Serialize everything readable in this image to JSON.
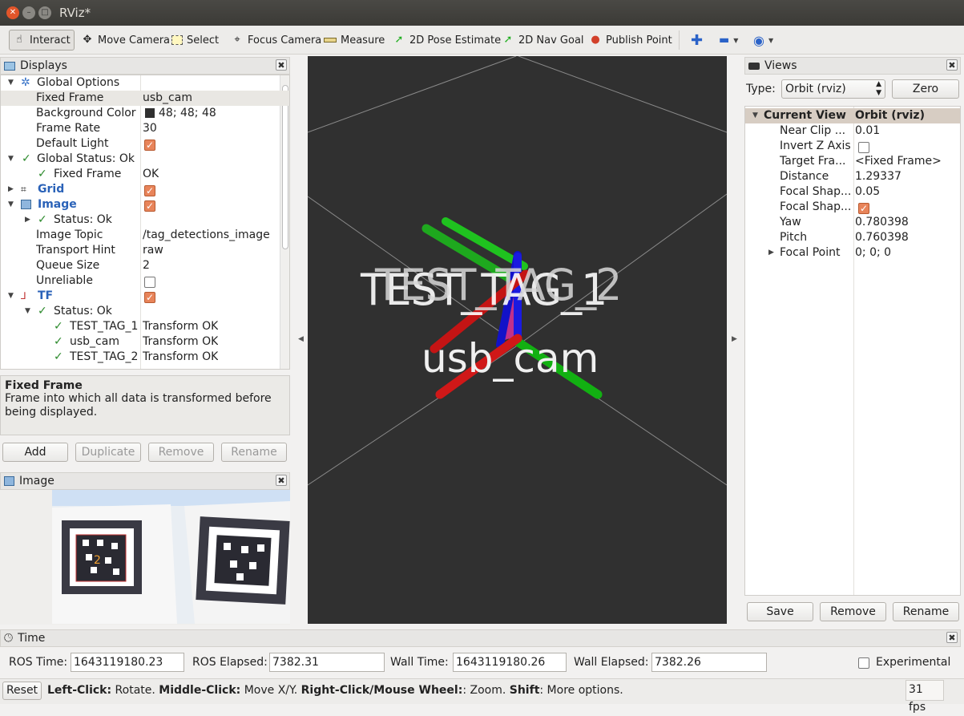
{
  "window": {
    "title": "RViz*"
  },
  "toolbar": {
    "interact": "Interact",
    "move_camera": "Move Camera",
    "select": "Select",
    "focus_camera": "Focus Camera",
    "measure": "Measure",
    "pose_estimate": "2D Pose Estimate",
    "nav_goal": "2D Nav Goal",
    "publish_point": "Publish Point"
  },
  "displays": {
    "title": "Displays",
    "rows": [
      {
        "label": "Global Options",
        "value": ""
      },
      {
        "label": "Fixed Frame",
        "value": "usb_cam"
      },
      {
        "label": "Background Color",
        "value": "48; 48; 48"
      },
      {
        "label": "Frame Rate",
        "value": "30"
      },
      {
        "label": "Default Light",
        "value": ""
      },
      {
        "label": "Global Status: Ok",
        "value": ""
      },
      {
        "label": "Fixed Frame",
        "value": "OK"
      },
      {
        "label": "Grid",
        "value": ""
      },
      {
        "label": "Image",
        "value": ""
      },
      {
        "label": "Status: Ok",
        "value": ""
      },
      {
        "label": "Image Topic",
        "value": "/tag_detections_image"
      },
      {
        "label": "Transport Hint",
        "value": "raw"
      },
      {
        "label": "Queue Size",
        "value": "2"
      },
      {
        "label": "Unreliable",
        "value": ""
      },
      {
        "label": "TF",
        "value": ""
      },
      {
        "label": "Status: Ok",
        "value": ""
      },
      {
        "label": "TEST_TAG_1",
        "value": "Transform OK"
      },
      {
        "label": "usb_cam",
        "value": "Transform OK"
      },
      {
        "label": "TEST_TAG_2",
        "value": "Transform OK"
      }
    ],
    "desc_title": "Fixed Frame",
    "desc_text": "Frame into which all data is transformed before being displayed.",
    "buttons": {
      "add": "Add",
      "duplicate": "Duplicate",
      "remove": "Remove",
      "rename": "Rename"
    }
  },
  "image_panel": {
    "title": "Image"
  },
  "viewport": {
    "labels": {
      "tag1": "TEST_TAG_1",
      "tag2": "TEST_TAG_2",
      "cam": "usb_cam"
    },
    "bg_color": "#303030"
  },
  "views": {
    "title": "Views",
    "type_label": "Type:",
    "type_value": "Orbit (rviz)",
    "zero": "Zero",
    "header_k": "Current View",
    "header_v": "Orbit (rviz)",
    "rows": [
      {
        "label": "Near Clip ...",
        "value": "0.01"
      },
      {
        "label": "Invert Z Axis",
        "value": ""
      },
      {
        "label": "Target Fra...",
        "value": "<Fixed Frame>"
      },
      {
        "label": "Distance",
        "value": "1.29337"
      },
      {
        "label": "Focal Shap...",
        "value": "0.05"
      },
      {
        "label": "Focal Shap...",
        "value": ""
      },
      {
        "label": "Yaw",
        "value": "0.780398"
      },
      {
        "label": "Pitch",
        "value": "0.760398"
      },
      {
        "label": "Focal Point",
        "value": "0; 0; 0"
      }
    ],
    "buttons": {
      "save": "Save",
      "remove": "Remove",
      "rename": "Rename"
    }
  },
  "time": {
    "title": "Time",
    "ros_time_label": "ROS Time:",
    "ros_time": "1643119180.23",
    "ros_elapsed_label": "ROS Elapsed:",
    "ros_elapsed": "7382.31",
    "wall_time_label": "Wall Time:",
    "wall_time": "1643119180.26",
    "wall_elapsed_label": "Wall Elapsed:",
    "wall_elapsed": "7382.26",
    "experimental": "Experimental"
  },
  "statusbar": {
    "reset": "Reset",
    "left_click": "Left-Click:",
    "rotate": " Rotate. ",
    "middle_click": "Middle-Click:",
    "move": " Move X/Y. ",
    "right_click": "Right-Click/Mouse Wheel:",
    "zoom": ": Zoom. ",
    "shift": "Shift",
    "more": ": More options.",
    "fps": "31 fps"
  }
}
